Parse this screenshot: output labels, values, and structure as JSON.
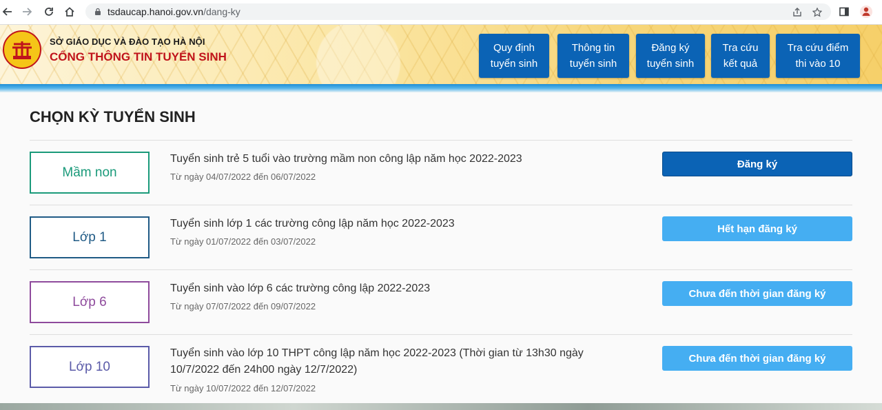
{
  "browser": {
    "url_host": "tsdaucap.hanoi.gov.vn",
    "url_path": "/dang-ky"
  },
  "header": {
    "org_name": "SỞ GIÁO DỤC VÀ ĐÀO TẠO HÀ NỘI",
    "portal_name": "CỔNG THÔNG TIN TUYỂN SINH",
    "menu": [
      {
        "line1": "Quy định",
        "line2": "tuyển sinh"
      },
      {
        "line1": "Thông tin",
        "line2": "tuyển sinh"
      },
      {
        "line1": "Đăng ký",
        "line2": "tuyển sinh"
      },
      {
        "line1": "Tra cứu",
        "line2": "kết quả"
      },
      {
        "line1": "Tra cứu điểm",
        "line2": "thi vào 10"
      }
    ]
  },
  "main": {
    "title": "CHỌN KỲ TUYỂN SINH",
    "rows": [
      {
        "level": "Mầm non",
        "title": "Tuyển sinh trẻ 5 tuổi vào trường mầm non công lập năm học 2022-2023",
        "date": "Từ ngày 04/07/2022 đến 06/07/2022",
        "action": "Đăng ký",
        "color": "#1a9a7a"
      },
      {
        "level": "Lớp 1",
        "title": "Tuyển sinh lớp 1 các trường công lập năm học 2022-2023",
        "date": "Từ ngày 01/07/2022 đến 03/07/2022",
        "action": "Hết hạn đăng ký",
        "color": "#1f5a85"
      },
      {
        "level": "Lớp 6",
        "title": "Tuyển sinh vào lớp 6 các trường công lập 2022-2023",
        "date": "Từ ngày 07/07/2022 đến 09/07/2022",
        "action": "Chưa đến thời gian đăng ký",
        "color": "#8e4a9c"
      },
      {
        "level": "Lớp 10",
        "title": "Tuyển sinh vào lớp 10 THPT công lập năm học 2022-2023 (Thời gian từ 13h30 ngày 10/7/2022 đến 24h00 ngày 12/7/2022)",
        "date": "Từ ngày 10/07/2022 đến 12/07/2022",
        "action": "Chưa đến thời gian đăng ký",
        "color": "#5a5aa8"
      }
    ]
  },
  "colors": {
    "primary": "#0b63b5",
    "light_button": "#45aef2",
    "portal_red": "#c0141b"
  }
}
